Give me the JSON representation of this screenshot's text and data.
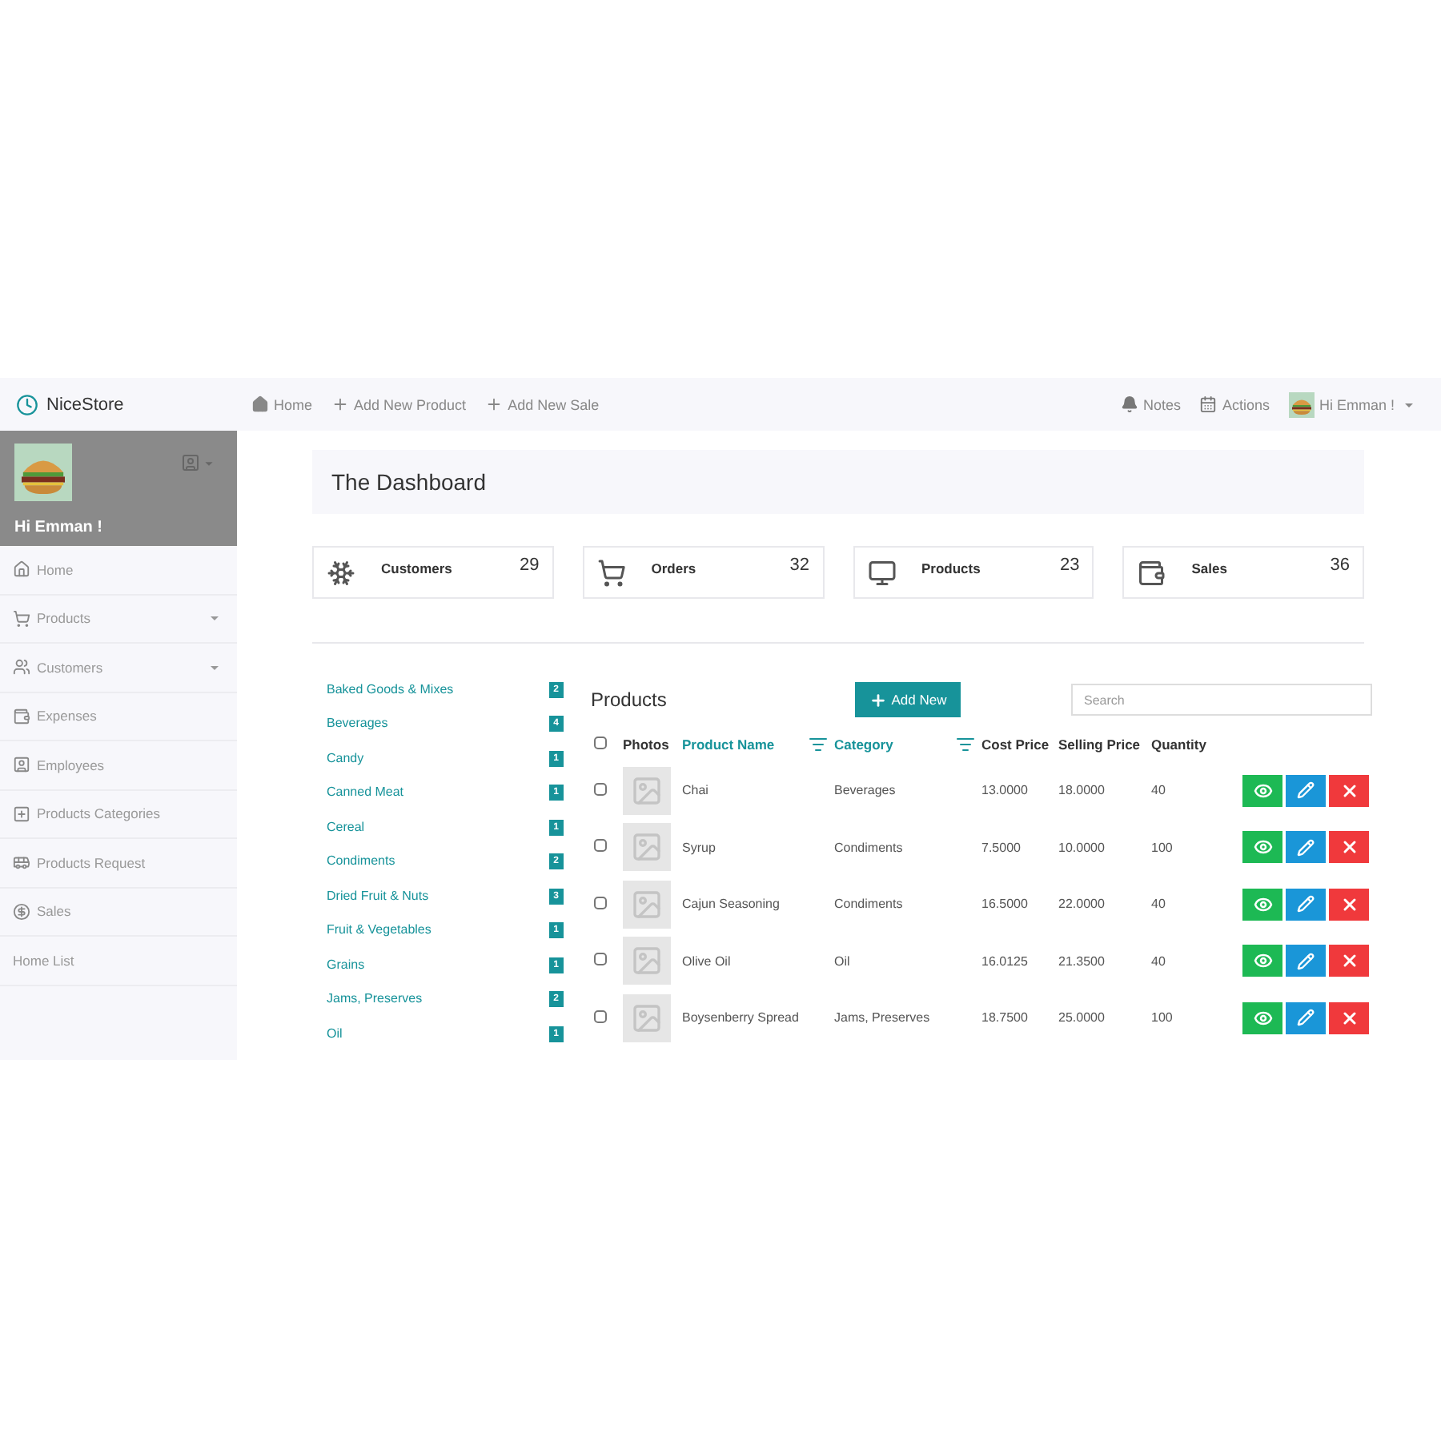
{
  "topbar": {
    "brand": "NiceStore",
    "links": [
      "Home",
      "Add New Product",
      "Add New Sale"
    ],
    "right": [
      "Notes",
      "Actions"
    ],
    "user": "Hi Emman !"
  },
  "sidebar": {
    "greeting": "Hi Emman !",
    "items": [
      {
        "label": "Home",
        "expandable": false
      },
      {
        "label": "Products",
        "expandable": true
      },
      {
        "label": "Customers",
        "expandable": true
      },
      {
        "label": "Expenses",
        "expandable": false
      },
      {
        "label": "Employees",
        "expandable": false
      },
      {
        "label": "Products Categories",
        "expandable": false
      },
      {
        "label": "Products Request",
        "expandable": false
      },
      {
        "label": "Sales",
        "expandable": false
      },
      {
        "label": "Home List",
        "expandable": false
      }
    ]
  },
  "title": "The Dashboard",
  "stats": [
    {
      "label": "Customers",
      "value": "29"
    },
    {
      "label": "Orders",
      "value": "32"
    },
    {
      "label": "Products",
      "value": "23"
    },
    {
      "label": "Sales",
      "value": "36"
    }
  ],
  "categories": [
    {
      "name": "Baked Goods & Mixes",
      "count": "2"
    },
    {
      "name": "Beverages",
      "count": "4"
    },
    {
      "name": "Candy",
      "count": "1"
    },
    {
      "name": "Canned Meat",
      "count": "1"
    },
    {
      "name": "Cereal",
      "count": "1"
    },
    {
      "name": "Condiments",
      "count": "2"
    },
    {
      "name": "Dried Fruit & Nuts",
      "count": "3"
    },
    {
      "name": "Fruit & Vegetables",
      "count": "1"
    },
    {
      "name": "Grains",
      "count": "1"
    },
    {
      "name": "Jams, Preserves",
      "count": "2"
    },
    {
      "name": "Oil",
      "count": "1"
    }
  ],
  "products": {
    "title": "Products",
    "add_button": "Add New",
    "search": {
      "placeholder": "Search"
    },
    "select_all": {
      "checked": false
    },
    "columns": [
      {
        "label": "Photos",
        "sortable": false
      },
      {
        "label": "Product Name",
        "sortable": true
      },
      {
        "label": "Category",
        "sortable": true
      },
      {
        "label": "Cost Price",
        "sortable": false
      },
      {
        "label": "Selling Price",
        "sortable": false
      },
      {
        "label": "Quantity",
        "sortable": false
      }
    ],
    "rows": [
      {
        "checked": false,
        "name": "Chai",
        "category": "Beverages",
        "cost": "13.0000",
        "selling": "18.0000",
        "quantity": "40"
      },
      {
        "checked": false,
        "name": "Syrup",
        "category": "Condiments",
        "cost": "7.5000",
        "selling": "10.0000",
        "quantity": "100"
      },
      {
        "checked": false,
        "name": "Cajun Seasoning",
        "category": "Condiments",
        "cost": "16.5000",
        "selling": "22.0000",
        "quantity": "40"
      },
      {
        "checked": false,
        "name": "Olive Oil",
        "category": "Oil",
        "cost": "16.0125",
        "selling": "21.3500",
        "quantity": "40"
      },
      {
        "checked": false,
        "name": "Boysenberry Spread",
        "category": "Jams, Preserves",
        "cost": "18.7500",
        "selling": "25.0000",
        "quantity": "100"
      }
    ]
  }
}
